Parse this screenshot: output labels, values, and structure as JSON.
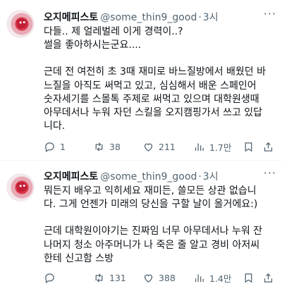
{
  "tweets": [
    {
      "author_name": "오지메피스토",
      "handle": "@some_thin9_good",
      "dot": "·",
      "time": "3시",
      "lines": [
        "다들.. 제 얼레벌레 이게 경력이..?",
        "썰을 좋아하시는군요....",
        "",
        "근데 전 여전히 초 3때 재미로 바느질방에서 배웠던 바",
        "느질을 아직도 써먹고 있고, 심심해서 배운 스페인어",
        "숫자세기를 스몰톡 주제로 써먹고 있으며 대학원생때",
        "아무데서나 누워 자던 스킬을 오지캠핑가서 쓰고 있답",
        "니다."
      ],
      "replies": "1",
      "retweets": "38",
      "likes": "211",
      "views": "1.7만"
    },
    {
      "author_name": "오지메피스토",
      "handle": "@some_thin9_good",
      "dot": "·",
      "time": "3시",
      "lines": [
        "뭐든지 배우고 익히세요 재미든, 쓸모든 상관 없습니",
        "다. 그게 언젠가 미래의 당신을 구할 날이 올거에요:)",
        "",
        "근데 대학원이야기는 진짜임 너무 아무데서나 누워 잔",
        "나머지 청소 아주머니가 나 죽은 줄 알고 경비 아저씨",
        "한테 신고함 스방"
      ],
      "replies": "",
      "retweets": "131",
      "likes": "388",
      "views": "1.4만"
    }
  ],
  "icons": {
    "avatar": "profile-avatar",
    "more": "more-icon",
    "reply": "reply-icon",
    "retweet": "retweet-icon",
    "like": "heart-icon",
    "views": "views-icon",
    "bookmark": "bookmark-icon",
    "share": "share-icon"
  },
  "colors": {
    "text": "#0f1419",
    "muted": "#536471",
    "divider": "#eff3f4"
  }
}
